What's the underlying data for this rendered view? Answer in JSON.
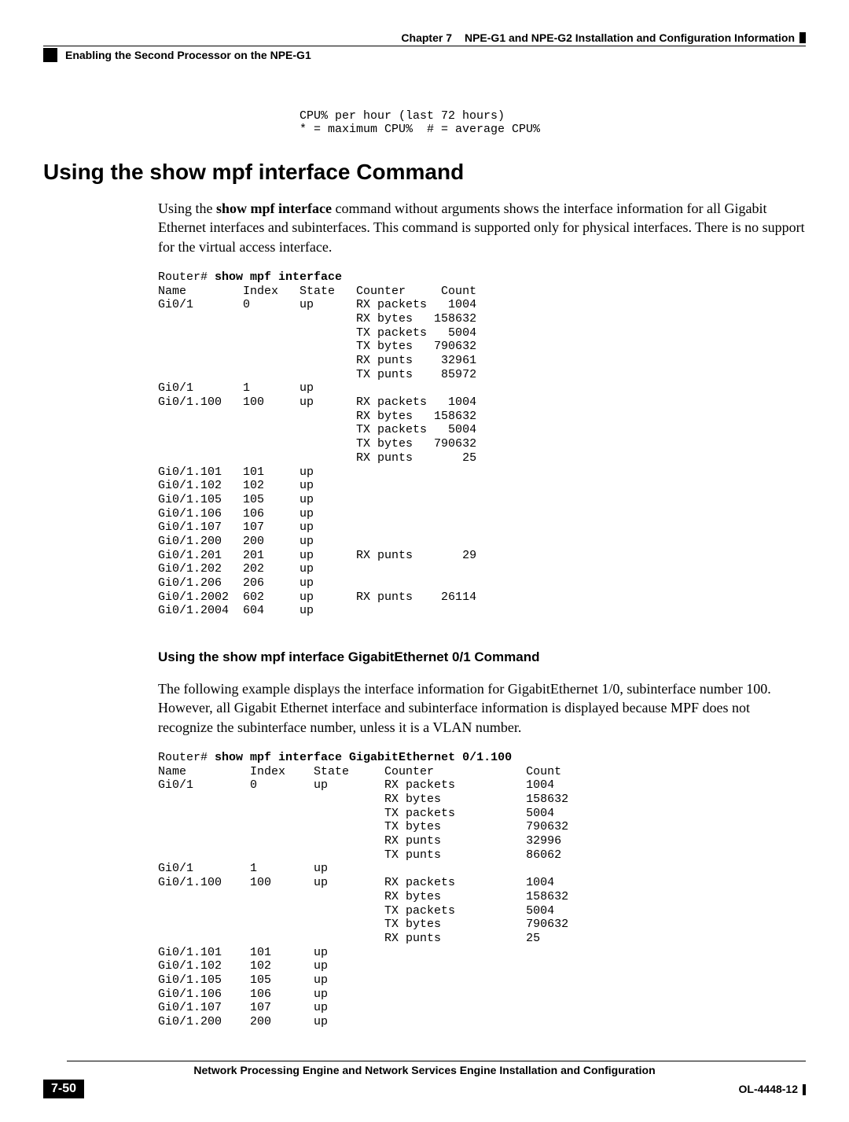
{
  "header": {
    "chapter_label": "Chapter 7",
    "chapter_title": "NPE-G1 and NPE-G2 Installation and Configuration Information",
    "section_title": "Enabling the Second Processor on the NPE-G1"
  },
  "cli_top": "    CPU% per hour (last 72 hours)\n    * = maximum CPU%  # = average CPU%",
  "section1": {
    "heading": "Using the show mpf interface Command",
    "para_pre": "Using the ",
    "para_cmd": "show mpf interface",
    "para_post": " command without arguments shows the interface information for all Gigabit Ethernet interfaces and subinterfaces. This command is supported only for physical interfaces. There is no support for the virtual access interface.",
    "cli_prompt": "Router# ",
    "cli_cmd": "show mpf interface",
    "cli_body": "Name        Index   State   Counter     Count\nGi0/1       0       up      RX packets   1004\n                            RX bytes   158632\n                            TX packets   5004\n                            TX bytes   790632\n                            RX punts    32961\n                            TX punts    85972\nGi0/1       1       up\nGi0/1.100   100     up      RX packets   1004\n                            RX bytes   158632\n                            TX packets   5004\n                            TX bytes   790632\n                            RX punts       25\nGi0/1.101   101     up\nGi0/1.102   102     up\nGi0/1.105   105     up\nGi0/1.106   106     up\nGi0/1.107   107     up\nGi0/1.200   200     up\nGi0/1.201   201     up      RX punts       29\nGi0/1.202   202     up\nGi0/1.206   206     up\nGi0/1.2002  602     up      RX punts    26114\nGi0/1.2004  604     up"
  },
  "section2": {
    "heading": "Using the show mpf interface GigabitEthernet 0/1 Command",
    "para": "The following example displays the interface information for GigabitEthernet 1/0, subinterface number 100. However, all Gigabit Ethernet interface and subinterface information is displayed because MPF does not recognize the subinterface number, unless it is a VLAN number.",
    "cli_prompt": "Router# ",
    "cli_cmd": "show mpf interface GigabitEthernet 0/1.100",
    "cli_body": "Name         Index    State     Counter             Count\nGi0/1        0        up        RX packets          1004\n                                RX bytes            158632\n                                TX packets          5004\n                                TX bytes            790632\n                                RX punts            32996\n                                TX punts            86062\nGi0/1        1        up\nGi0/1.100    100      up        RX packets          1004\n                                RX bytes            158632\n                                TX packets          5004\n                                TX bytes            790632\n                                RX punts            25\nGi0/1.101    101      up\nGi0/1.102    102      up\nGi0/1.105    105      up\nGi0/1.106    106      up\nGi0/1.107    107      up\nGi0/1.200    200      up"
  },
  "footer": {
    "book_title": "Network Processing Engine and Network Services Engine Installation and Configuration",
    "page_number": "7-50",
    "doc_id": "OL-4448-12"
  }
}
